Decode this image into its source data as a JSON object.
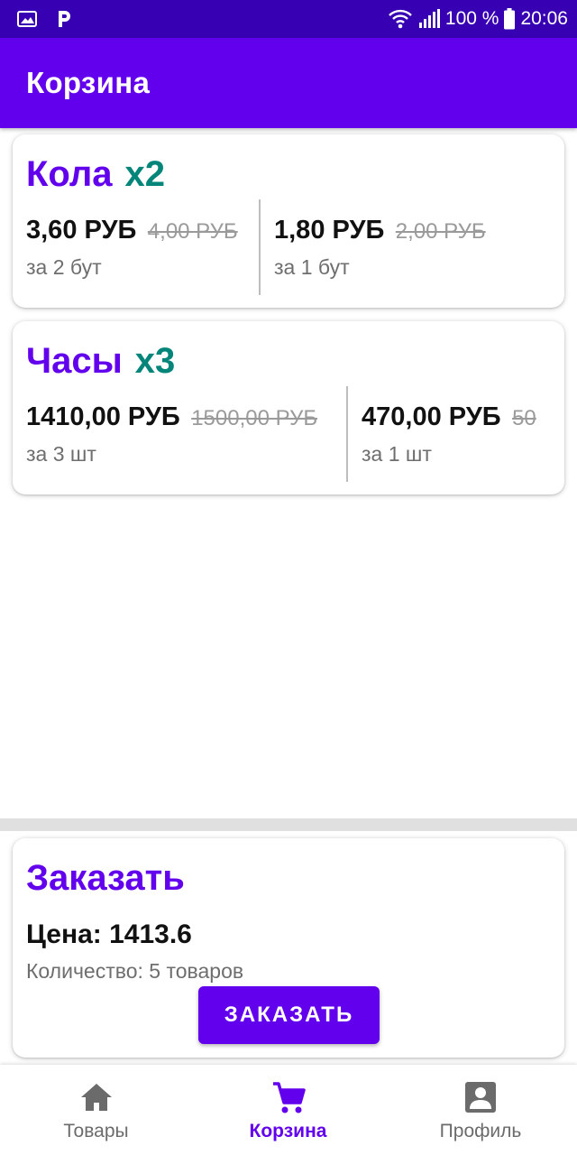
{
  "status_bar": {
    "left_icons": [
      "image-icon",
      "p-app-icon"
    ],
    "right_icons": [
      "wifi-icon",
      "signal-icon",
      "battery-icon"
    ],
    "battery": "100 %",
    "time": "20:06"
  },
  "app_bar": {
    "title": "Корзина"
  },
  "cart_items": [
    {
      "name": "Кола",
      "qty": "x2",
      "total_price": "3,60 РУБ",
      "total_old_price": "4,00 РУБ",
      "total_unit": "за 2 бут",
      "unit_price": "1,80 РУБ",
      "unit_old_price": "2,00 РУБ",
      "unit_label": "за 1 бут"
    },
    {
      "name": "Часы",
      "qty": "x3",
      "total_price": "1410,00 РУБ",
      "total_old_price": "1500,00 РУБ",
      "total_unit": "за 3 шт",
      "unit_price": "470,00 РУБ",
      "unit_old_price": "50",
      "unit_label": "за 1 шт"
    }
  ],
  "order": {
    "title": "Заказать",
    "price": "Цена: 1413.6",
    "count": "Количество: 5 товаров",
    "button_label": "ЗАКАЗАТЬ"
  },
  "bottom_nav": {
    "items": [
      {
        "label": "Товары",
        "icon": "home-icon",
        "active": false
      },
      {
        "label": "Корзина",
        "icon": "cart-icon",
        "active": true
      },
      {
        "label": "Профиль",
        "icon": "account-box-icon",
        "active": false
      }
    ]
  },
  "colors": {
    "primary": "#6200ee",
    "primary_dark": "#3700b3",
    "accent_qty": "#03857a",
    "inactive": "#6b6b6b"
  }
}
